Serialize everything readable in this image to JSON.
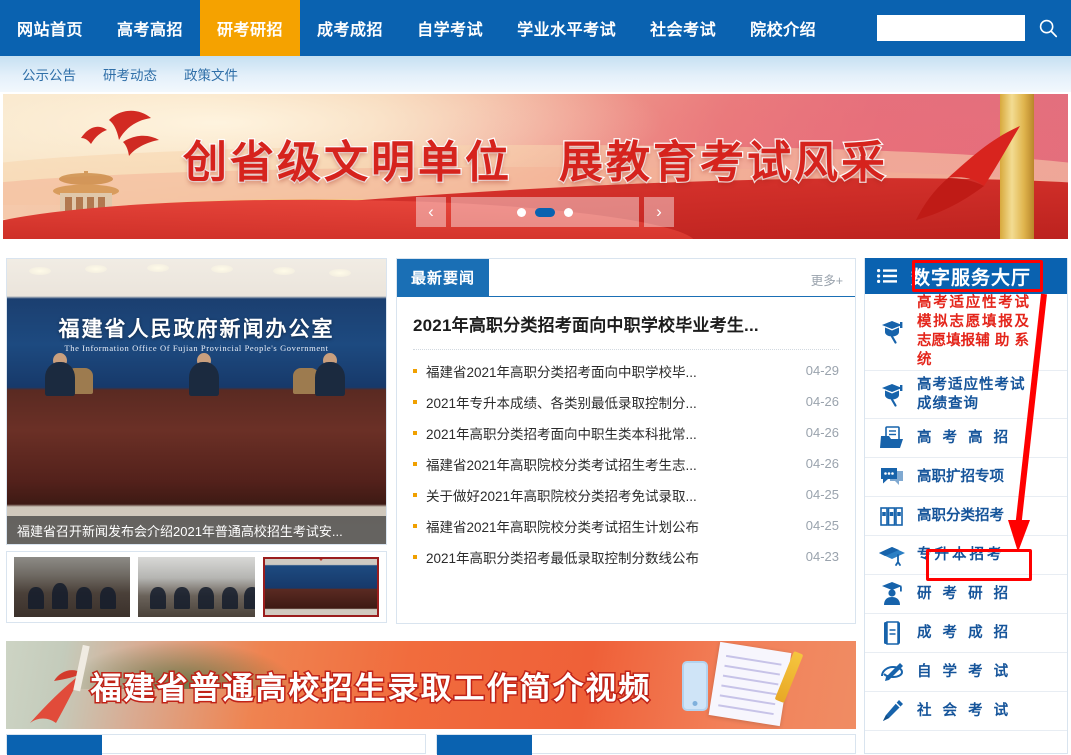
{
  "topnav": {
    "items": [
      {
        "label": "网站首页",
        "active": false
      },
      {
        "label": "高考高招",
        "active": false
      },
      {
        "label": "研考研招",
        "active": true
      },
      {
        "label": "成考成招",
        "active": false
      },
      {
        "label": "自学考试",
        "active": false
      },
      {
        "label": "学业水平考试",
        "active": false
      },
      {
        "label": "社会考试",
        "active": false
      },
      {
        "label": "院校介绍",
        "active": false
      }
    ],
    "search": {
      "value": "",
      "placeholder": "",
      "icon": "search-icon"
    },
    "active_color": "#f5a200",
    "bar_color": "#0a62b0"
  },
  "subnav": {
    "items": [
      "公示公告",
      "研考动态",
      "政策文件"
    ]
  },
  "hero": {
    "title": "创省级文明单位　展教育考试风采",
    "prev_icon": "chevron-left-icon",
    "next_icon": "chevron-right-icon",
    "dots": [
      "",
      "",
      ""
    ],
    "active_dot_index": 1,
    "accent": "#d6231d"
  },
  "photo": {
    "wall_title": "福建省人民政府新闻办公室",
    "wall_subtitle": "The Information Office Of Fujian Provincial People's Government",
    "caption": "福建省召开新闻发布会介绍2021年普通高校招生考试安...",
    "thumbs": [
      "thumbnail-1",
      "thumbnail-2",
      "thumbnail-3-selected"
    ]
  },
  "news": {
    "tab_label": "最新要闻",
    "more_label": "更多+",
    "lead": "2021年高职分类招考面向中职学校毕业考生...",
    "items": [
      {
        "title": "福建省2021年高职分类招考面向中职学校毕...",
        "date": "04-29"
      },
      {
        "title": "2021年专升本成绩、各类别最低录取控制分...",
        "date": "04-26"
      },
      {
        "title": "2021年高职分类招考面向中职生类本科批常...",
        "date": "04-26"
      },
      {
        "title": "福建省2021年高职院校分类考试招生考生志...",
        "date": "04-26"
      },
      {
        "title": "关于做好2021年高职院校分类招考免试录取...",
        "date": "04-25"
      },
      {
        "title": "福建省2021年高职院校分类考试招生计划公布",
        "date": "04-25"
      },
      {
        "title": "2021年高职分类招考最低录取控制分数线公布",
        "date": "04-23"
      }
    ]
  },
  "video_banner": {
    "title": "福建省普通高校招生录取工作简介视频"
  },
  "sidebar": {
    "menu_icon": "hamburger-menu-icon",
    "title": "数字服务大厅",
    "items": [
      {
        "label": "高考适应性考试模拟志愿填报及志愿填报辅 助 系 统",
        "icon": "graduation-search-icon",
        "style": "red",
        "size": "tall"
      },
      {
        "label": "高考适应性考试成绩查询",
        "icon": "graduation-search-icon",
        "style": "blue",
        "size": "mid"
      },
      {
        "label": "高 考 高 招",
        "icon": "folder-document-icon",
        "style": "blue",
        "size": "normal"
      },
      {
        "label": "高职扩招专项",
        "icon": "chat-bubble-icon",
        "style": "blue",
        "size": "normal"
      },
      {
        "label": "高职分类招考",
        "icon": "binders-icon",
        "style": "blue",
        "size": "normal"
      },
      {
        "label": "专升本招考",
        "icon": "graduation-cap-icon",
        "style": "blue",
        "size": "normal",
        "highlighted": true
      },
      {
        "label": "研 考 研 招",
        "icon": "graduate-person-icon",
        "style": "blue",
        "size": "normal"
      },
      {
        "label": "成 考 成 招",
        "icon": "book-icon",
        "style": "blue",
        "size": "normal"
      },
      {
        "label": "自 学 考 试",
        "icon": "scroll-pen-icon",
        "style": "blue",
        "size": "normal"
      },
      {
        "label": "社 会 考 试",
        "icon": "fountain-pen-icon",
        "style": "blue",
        "size": "normal"
      }
    ]
  },
  "annotations": {
    "highlight_color": "#ff0000",
    "box_titles": [
      "数字服务大厅",
      "专升本招考"
    ]
  }
}
